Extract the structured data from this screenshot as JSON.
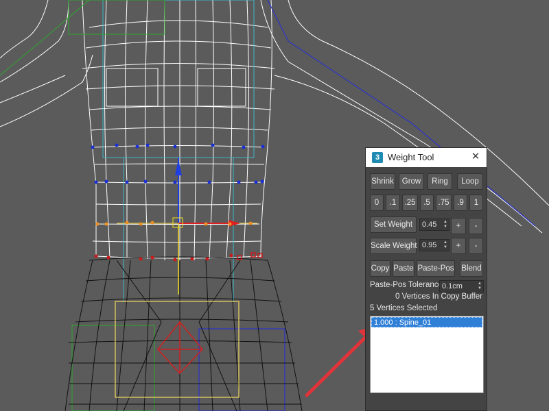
{
  "window": {
    "title": "Weight Tool",
    "app_icon_glyph": "3",
    "close_glyph": "✕"
  },
  "buttons_row1": [
    "Shrink",
    "Grow",
    "Ring",
    "Loop"
  ],
  "weight_presets": [
    "0",
    ".1",
    ".25",
    ".5",
    ".75",
    ".9",
    "1"
  ],
  "set_weight": {
    "label": "Set Weight",
    "value": "0.45",
    "plus": "+",
    "minus": "-"
  },
  "scale_weight": {
    "label": "Scale Weight",
    "value": "0.95",
    "plus": "+",
    "minus": "-"
  },
  "buttons_row_copy": [
    "Copy",
    "Paste",
    "Paste-Pos",
    "Blend"
  ],
  "paste_pos": {
    "label": "Paste-Pos Tolerance",
    "value": "0.1cm"
  },
  "copy_buffer_status": "0 Vertices In Copy Buffer",
  "selection_status": "5 Vertices Selected",
  "bone_list": [
    "1.000 : Spine_01"
  ],
  "colors": {
    "accent": "#2f7fd7",
    "arrow": "#e0333a",
    "viewport_bg": "#5b5b5b"
  }
}
